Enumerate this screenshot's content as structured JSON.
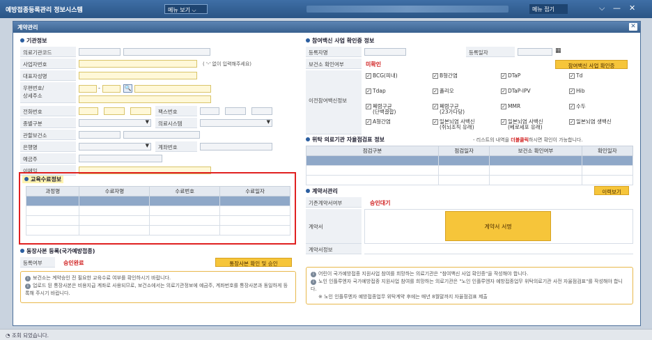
{
  "app": {
    "title": "예방접종등록관리 정보시스템",
    "menu_label": "메뉴 보기",
    "menu_right": "메뉴 접기",
    "min": "—",
    "close": "✕"
  },
  "dialog": {
    "title": "계약관리",
    "close": "✕"
  },
  "org": {
    "section": "기관정보",
    "labels": {
      "code": "의료기관코드",
      "bizno": "사업자번호",
      "rep": "대표자성명",
      "addr": "우편번호/\n상세주소",
      "tel": "전화번호",
      "fax": "팩스번호",
      "type": "종별구분",
      "system": "의료시스템",
      "hc": "관할보건소",
      "bank": "은행명",
      "account": "계좌번호",
      "holder": "예금주",
      "email": "이메일"
    },
    "bizno_hint": "( '-' 없이 입력해주세요)"
  },
  "edu": {
    "section": "교육수료정보",
    "headers": [
      "과정명",
      "수료자명",
      "수료번호",
      "수료일자"
    ]
  },
  "clinic": {
    "section": "동장사본 등록(국가예방접종)",
    "reg_label": "등록여부",
    "reg_value": "승인완료",
    "button": "통장사본 확인 및 승인"
  },
  "vaccine": {
    "section": "참여백신 사업 확인증 정보",
    "reg_label": "등록자명",
    "date_label": "등록일자",
    "hc_check_label": "보건소 확인여부",
    "hc_check_value": "미확인",
    "button": "참여백신 사업 확인증",
    "prev_label": "이전참여백신정보",
    "items": [
      "BCG(피내)",
      "B형간염",
      "DTaP",
      "Td",
      "Tdap",
      "폴리오",
      "DTaP-IPV",
      "Hib",
      "폐렴구균\n(단백결합)",
      "폐렴구균\n(23가다당)",
      "MMR",
      "수두",
      "A형간염",
      "일본뇌염 사백신\n(쥐뇌조직 유래)",
      "일본뇌염 사백신\n(베로세포 유래)",
      "일본뇌염 생백신"
    ]
  },
  "consign": {
    "section": "위탁 의료기관 자율점검표 정보",
    "hint": "- 리스트의 내역을 더블클릭하시면 확인이 가능합니다.",
    "hint_em": "더블클릭",
    "headers": [
      "점검구분",
      "점검일자",
      "보건소 확인여부",
      "확인일자"
    ]
  },
  "contract": {
    "section": "계약서관리",
    "history_button": "이력보기",
    "labels": {
      "exist": "기존계약서여부",
      "contract": "계약서",
      "info": "계약서정보"
    },
    "exist_value": "승인대기",
    "sign_button": "계약서 서명"
  },
  "notes": {
    "left": [
      "보건소는 계약승인 전 필요한 교육수료 여부를 확인하시기 바랍니다.",
      "업로드 된 통장사본은 비용지급 계좌로 사용되므로, 보건소에서는 의료기관정보에 예금주, 계좌번호를 통장사본과 동일하게 등록해 주시기 바랍니다."
    ],
    "right": [
      "어린이 국가예방접종 지원사업 참여를 희망하는 의료기관은 \"참여백신 사업 확인증\"을 작성해야 합니다.",
      "노인 인플루엔자 국가예방접종 지원사업 참여를 희망하는 의료기관은 \"노인 인플루엔자 예방접종업무 위탁의료기관 사전 자율점검표\"를 작성해야 합니다.",
      "※ 노인 인플루엔자 예방접종업무 위탁계약 후에는 매년 8월말까지 자율점검표 제출"
    ]
  },
  "status": {
    "text": "조회 되었습니다."
  },
  "colors": {
    "accent": "#2b5ea0",
    "highlight_red": "#e02020",
    "button_orange": "#f6c53a"
  }
}
